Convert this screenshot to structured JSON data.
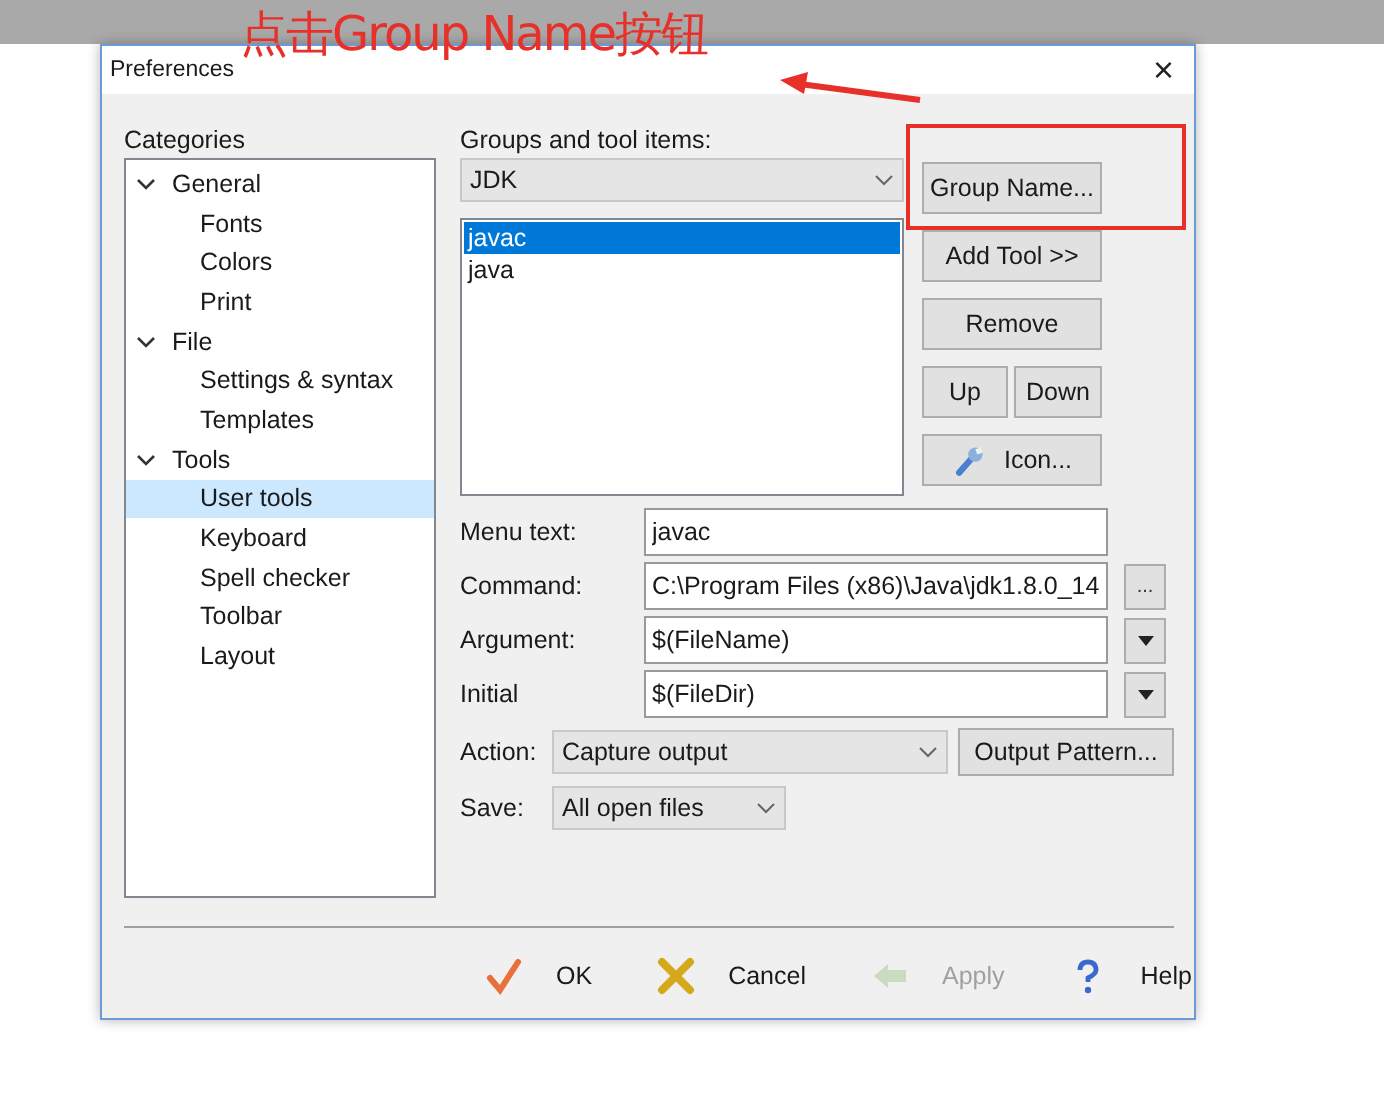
{
  "annotation": {
    "text": "点击Group Name按钮"
  },
  "window": {
    "title": "Preferences",
    "close": "×"
  },
  "categories": {
    "label": "Categories",
    "items": [
      {
        "label": "General",
        "expanded": true,
        "selected": false,
        "children": [
          {
            "label": "Fonts",
            "selected": false
          },
          {
            "label": "Colors",
            "selected": false
          },
          {
            "label": "Print",
            "selected": false
          }
        ]
      },
      {
        "label": "File",
        "expanded": true,
        "selected": false,
        "children": [
          {
            "label": "Settings & syntax",
            "selected": false
          },
          {
            "label": "Templates",
            "selected": false
          }
        ]
      },
      {
        "label": "Tools",
        "expanded": true,
        "selected": false,
        "children": [
          {
            "label": "User tools",
            "selected": true
          },
          {
            "label": "Keyboard",
            "selected": false
          },
          {
            "label": "Spell checker",
            "selected": false
          },
          {
            "label": "Toolbar",
            "selected": false
          },
          {
            "label": "Layout",
            "selected": false
          }
        ]
      }
    ]
  },
  "groups": {
    "label": "Groups and tool items:",
    "group": "JDK",
    "items": [
      {
        "label": "javac",
        "selected": true
      },
      {
        "label": "java",
        "selected": false
      }
    ]
  },
  "side_buttons": {
    "group_name": "Group Name...",
    "add_tool": "Add Tool >>",
    "remove": "Remove",
    "up": "Up",
    "down": "Down",
    "icon": "Icon..."
  },
  "form": {
    "menu_text": {
      "label": "Menu text:",
      "value": "javac"
    },
    "command": {
      "label": "Command:",
      "value": "C:\\Program Files (x86)\\Java\\jdk1.8.0_14",
      "browse": "..."
    },
    "argument": {
      "label": "Argument:",
      "value": "$(FileName)"
    },
    "initial": {
      "label": "Initial",
      "value": "$(FileDir)"
    },
    "action": {
      "label": "Action:",
      "value": "Capture output",
      "button": "Output Pattern..."
    },
    "save": {
      "label": "Save:",
      "value": "All open files"
    }
  },
  "buttons": [
    {
      "kind": "ok",
      "label": "OK",
      "disabled": false
    },
    {
      "kind": "cancel",
      "label": "Cancel",
      "disabled": false
    },
    {
      "kind": "apply",
      "label": "Apply",
      "disabled": true
    },
    {
      "kind": "help",
      "label": "Help",
      "disabled": false
    }
  ]
}
